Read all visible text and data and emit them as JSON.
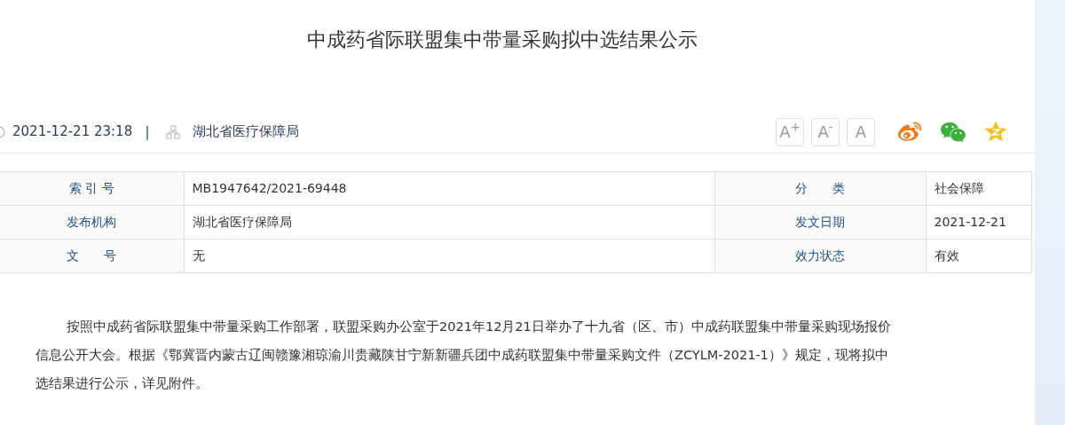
{
  "title": "中成药省际联盟集中带量采购拟中选结果公示",
  "meta": {
    "datetime": "2021-12-21 23:18",
    "separator": "|",
    "source": "湖北省医疗保障局"
  },
  "font_buttons": [
    {
      "label": "A$^{+}$"
    },
    {
      "label": "A$^{-}$"
    },
    {
      "label": "A"
    }
  ],
  "share": [
    {
      "kind": "weibo"
    },
    {
      "kind": "wechat"
    },
    {
      "kind": "qzone"
    }
  ],
  "info_table": [
    {
      "label_1": "索 引 号",
      "value_1": "MB1947642/2021-69448",
      "label_2": "分　　类",
      "value_2": "社会保障"
    },
    {
      "label_1": "发布机构",
      "value_1": "湖北省医疗保障局",
      "label_2": "发文日期",
      "value_2": "2021-12-21"
    },
    {
      "label_1": "文　　号",
      "value_1": "无",
      "label_2": "效力状态",
      "value_2": "有效"
    }
  ],
  "body": {
    "lines": [
      "按照中成药省际联盟集中带量采购工作部署，联盟采购办公室于2021年12月21日举办了十九省（区、市）中成药联盟集中带量采购现场报价",
      "信息公开大会。根据《鄂冀晋内蒙古辽闽赣豫湘琼渝川贵藏陕甘宁新新疆兵团中成药联盟集中带量采购文件（ZCYLM-2021-1）》规定，现将拟中",
      "选结果进行公示，详见附件。"
    ]
  }
}
